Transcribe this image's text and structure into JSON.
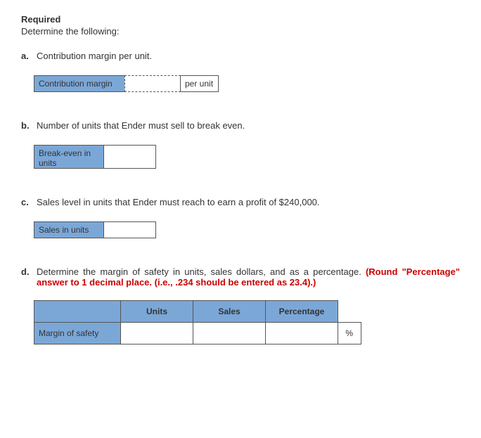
{
  "header": {
    "required": "Required",
    "instruction": "Determine the following:"
  },
  "a": {
    "letter": "a.",
    "text": "Contribution margin per unit.",
    "label": "Contribution margin",
    "suffix": "per unit"
  },
  "b": {
    "letter": "b.",
    "text": "Number of units that Ender must sell to break even.",
    "label": "Break-even in units"
  },
  "c": {
    "letter": "c.",
    "text": "Sales level in units that Ender must reach to earn a profit of $240,000.",
    "label": "Sales in units"
  },
  "d": {
    "letter": "d.",
    "text_part1": "Determine the margin of safety in units, sales dollars, and as a percentage. ",
    "text_part2": "(Round \"Percentage\" answer to 1 decimal place. (i.e., .234 should be entered as 23.4).)",
    "col_units": "Units",
    "col_sales": "Sales",
    "col_percentage": "Percentage",
    "row_label": "Margin of safety",
    "percent_sign": "%"
  }
}
